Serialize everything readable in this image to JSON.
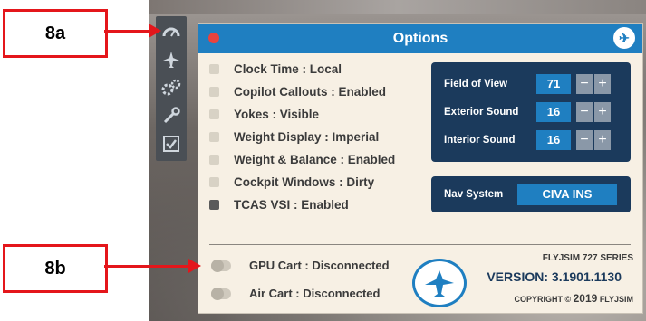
{
  "window": {
    "title": "Options"
  },
  "sidebar": {
    "items": [
      {
        "icon": "gauge-icon"
      },
      {
        "icon": "plane-icon"
      },
      {
        "icon": "gears-icon"
      },
      {
        "icon": "wrench-icon"
      },
      {
        "icon": "checklist-icon"
      }
    ]
  },
  "options": [
    {
      "label": "Clock Time : Local",
      "checked": false
    },
    {
      "label": "Copilot Callouts : Enabled",
      "checked": false
    },
    {
      "label": "Yokes : Visible",
      "checked": false
    },
    {
      "label": "Weight Display : Imperial",
      "checked": false
    },
    {
      "label": "Weight & Balance : Enabled",
      "checked": false
    },
    {
      "label": "Cockpit Windows : Dirty",
      "checked": false
    },
    {
      "label": "TCAS VSI : Enabled",
      "checked": true
    }
  ],
  "settings": [
    {
      "label": "Field of View",
      "value": "71",
      "minus": "−",
      "plus": "+"
    },
    {
      "label": "Exterior Sound",
      "value": "16",
      "minus": "−",
      "plus": "+"
    },
    {
      "label": "Interior Sound",
      "value": "16",
      "minus": "−",
      "plus": "+"
    }
  ],
  "nav": {
    "label": "Nav System",
    "value": "CIVA INS"
  },
  "toggles": [
    {
      "label": "GPU Cart : Disconnected",
      "on": false
    },
    {
      "label": "Air Cart : Disconnected",
      "on": false
    }
  ],
  "brand": {
    "series": "FLYJSIM 727 SERIES",
    "version": "VERSION: 3.1901.1130",
    "copyright_prefix": "COPYRIGHT © ",
    "copyright_year": "2019",
    "copyright_suffix": " FLYJSIM"
  },
  "callouts": {
    "a": "8a",
    "b": "8b"
  },
  "colors": {
    "accent": "#1f7fc1",
    "panel": "#1b3a5c",
    "callout": "#e4161b",
    "close": "#e9433e"
  }
}
